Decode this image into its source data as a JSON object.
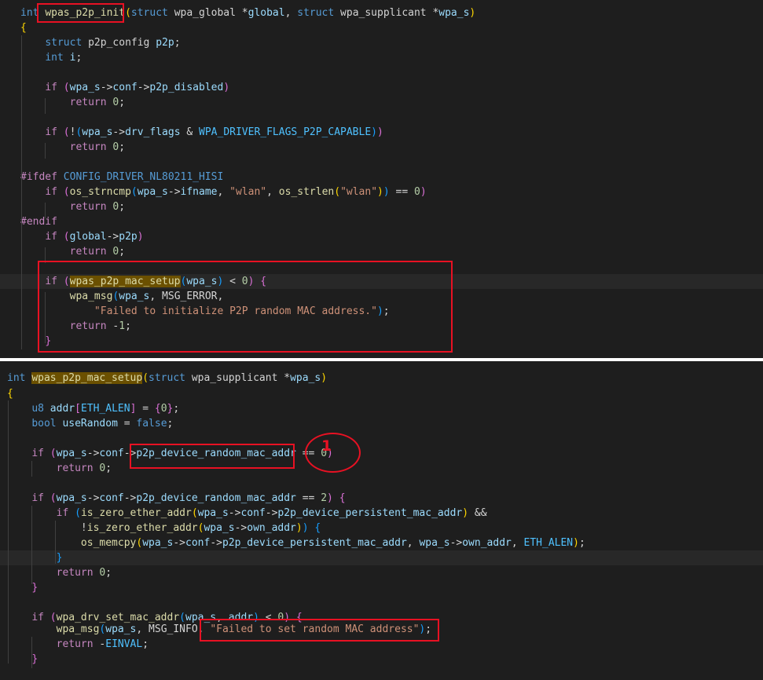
{
  "top_panel": {
    "lines": [
      [
        [
          "k",
          "int"
        ],
        [
          "t",
          " "
        ],
        [
          "f",
          "wpas_p2p_init"
        ],
        [
          "y",
          "("
        ],
        [
          "k",
          "struct"
        ],
        [
          "t",
          " "
        ],
        [
          "t",
          "wpa_global"
        ],
        [
          "t",
          " *"
        ],
        [
          "v",
          "global"
        ],
        [
          "t",
          ", "
        ],
        [
          "k",
          "struct"
        ],
        [
          "t",
          " "
        ],
        [
          "t",
          "wpa_supplicant"
        ],
        [
          "t",
          " *"
        ],
        [
          "v",
          "wpa_s"
        ],
        [
          "y",
          ")"
        ]
      ],
      [
        [
          "y",
          "{"
        ]
      ],
      [
        [
          "t",
          "    "
        ],
        [
          "k",
          "struct"
        ],
        [
          "t",
          " p2p_config "
        ],
        [
          "v",
          "p2p"
        ],
        [
          "t",
          ";"
        ]
      ],
      [
        [
          "t",
          "    "
        ],
        [
          "k",
          "int"
        ],
        [
          "t",
          " "
        ],
        [
          "v",
          "i"
        ],
        [
          "t",
          ";"
        ]
      ],
      [],
      [
        [
          "t",
          "    "
        ],
        [
          "pp",
          "if"
        ],
        [
          "t",
          " "
        ],
        [
          "p",
          "("
        ],
        [
          "v",
          "wpa_s"
        ],
        [
          "t",
          "->"
        ],
        [
          "v",
          "conf"
        ],
        [
          "t",
          "->"
        ],
        [
          "v",
          "p2p_disabled"
        ],
        [
          "p",
          ")"
        ]
      ],
      [
        [
          "t",
          "        "
        ],
        [
          "pp",
          "return"
        ],
        [
          "t",
          " "
        ],
        [
          "n",
          "0"
        ],
        [
          "t",
          ";"
        ]
      ],
      [],
      [
        [
          "t",
          "    "
        ],
        [
          "pp",
          "if"
        ],
        [
          "t",
          " "
        ],
        [
          "p",
          "("
        ],
        [
          "t",
          "!"
        ],
        [
          "bl",
          "("
        ],
        [
          "v",
          "wpa_s"
        ],
        [
          "t",
          "->"
        ],
        [
          "v",
          "drv_flags"
        ],
        [
          "t",
          " & "
        ],
        [
          "m",
          "WPA_DRIVER_FLAGS_P2P_CAPABLE"
        ],
        [
          "bl",
          ")"
        ],
        [
          "p",
          ")"
        ]
      ],
      [
        [
          "t",
          "        "
        ],
        [
          "pp",
          "return"
        ],
        [
          "t",
          " "
        ],
        [
          "n",
          "0"
        ],
        [
          "t",
          ";"
        ]
      ],
      [],
      [
        [
          "pp",
          "#ifdef"
        ],
        [
          "t",
          " "
        ],
        [
          "k",
          "CONFIG_DRIVER_NL80211_HISI"
        ]
      ],
      [
        [
          "t",
          "    "
        ],
        [
          "pp",
          "if"
        ],
        [
          "t",
          " "
        ],
        [
          "p",
          "("
        ],
        [
          "f",
          "os_strncmp"
        ],
        [
          "bl",
          "("
        ],
        [
          "v",
          "wpa_s"
        ],
        [
          "t",
          "->"
        ],
        [
          "v",
          "ifname"
        ],
        [
          "t",
          ", "
        ],
        [
          "s",
          "\"wlan\""
        ],
        [
          "t",
          ", "
        ],
        [
          "f",
          "os_strlen"
        ],
        [
          "y",
          "("
        ],
        [
          "s",
          "\"wlan\""
        ],
        [
          "y",
          ")"
        ],
        [
          "bl",
          ")"
        ],
        [
          "t",
          " == "
        ],
        [
          "n",
          "0"
        ],
        [
          "p",
          ")"
        ]
      ],
      [
        [
          "t",
          "        "
        ],
        [
          "pp",
          "return"
        ],
        [
          "t",
          " "
        ],
        [
          "n",
          "0"
        ],
        [
          "t",
          ";"
        ]
      ],
      [
        [
          "pp",
          "#endif"
        ]
      ],
      [
        [
          "t",
          "    "
        ],
        [
          "pp",
          "if"
        ],
        [
          "t",
          " "
        ],
        [
          "p",
          "("
        ],
        [
          "v",
          "global"
        ],
        [
          "t",
          "->"
        ],
        [
          "v",
          "p2p"
        ],
        [
          "p",
          ")"
        ]
      ],
      [
        [
          "t",
          "        "
        ],
        [
          "pp",
          "return"
        ],
        [
          "t",
          " "
        ],
        [
          "n",
          "0"
        ],
        [
          "t",
          ";"
        ]
      ],
      [],
      [
        [
          "t",
          "    "
        ],
        [
          "pp",
          "if"
        ],
        [
          "t",
          " "
        ],
        [
          "p",
          "("
        ],
        [
          "match",
          "wpas_p2p_mac_setup"
        ],
        [
          "bl",
          "("
        ],
        [
          "v",
          "wpa_s"
        ],
        [
          "bl",
          ")"
        ],
        [
          "t",
          " < "
        ],
        [
          "n",
          "0"
        ],
        [
          "p",
          ")"
        ],
        [
          "t",
          " "
        ],
        [
          "p",
          "{"
        ]
      ],
      [
        [
          "t",
          "        "
        ],
        [
          "f",
          "wpa_msg"
        ],
        [
          "bl",
          "("
        ],
        [
          "v",
          "wpa_s"
        ],
        [
          "t",
          ", MSG_ERROR,"
        ]
      ],
      [
        [
          "t",
          "            "
        ],
        [
          "s",
          "\"Failed to initialize P2P random MAC address.\""
        ],
        [
          "bl",
          ")"
        ],
        [
          "t",
          ";"
        ]
      ],
      [
        [
          "t",
          "        "
        ],
        [
          "pp",
          "return"
        ],
        [
          "t",
          " -"
        ],
        [
          "n",
          "1"
        ],
        [
          "t",
          ";"
        ]
      ],
      [
        [
          "t",
          "    "
        ],
        [
          "p",
          "}"
        ]
      ]
    ]
  },
  "bottom_panel": {
    "lines": [
      [
        [
          "k",
          "int"
        ],
        [
          "t",
          " "
        ],
        [
          "match",
          "wpas_p2p_mac_setup"
        ],
        [
          "y",
          "("
        ],
        [
          "k",
          "struct"
        ],
        [
          "t",
          " wpa_supplicant *"
        ],
        [
          "v",
          "wpa_s"
        ],
        [
          "y",
          ")"
        ]
      ],
      [
        [
          "y",
          "{"
        ]
      ],
      [],
      [
        [
          "t",
          "    "
        ],
        [
          "k",
          "u8"
        ],
        [
          "t",
          " "
        ],
        [
          "v",
          "addr"
        ],
        [
          "p",
          "["
        ],
        [
          "m",
          "ETH_ALEN"
        ],
        [
          "p",
          "]"
        ],
        [
          "t",
          " = "
        ],
        [
          "p",
          "{"
        ],
        [
          "n",
          "0"
        ],
        [
          "p",
          "}"
        ],
        [
          "t",
          ";"
        ]
      ],
      [
        [
          "t",
          "    "
        ],
        [
          "k",
          "bool"
        ],
        [
          "t",
          " "
        ],
        [
          "v",
          "useRandom"
        ],
        [
          "t",
          " = "
        ],
        [
          "k",
          "false"
        ],
        [
          "t",
          ";"
        ]
      ],
      [],
      [
        [
          "t",
          "    "
        ],
        [
          "pp",
          "if"
        ],
        [
          "t",
          " "
        ],
        [
          "p",
          "("
        ],
        [
          "v",
          "wpa_s"
        ],
        [
          "t",
          "->"
        ],
        [
          "v",
          "conf"
        ],
        [
          "t",
          "->"
        ],
        [
          "v",
          "p2p_device_random_mac_addr"
        ],
        [
          "t",
          " == "
        ],
        [
          "n",
          "0"
        ],
        [
          "p",
          ")"
        ]
      ],
      [
        [
          "t",
          "        "
        ],
        [
          "pp",
          "return"
        ],
        [
          "t",
          " "
        ],
        [
          "n",
          "0"
        ],
        [
          "t",
          ";"
        ]
      ],
      [],
      [
        [
          "t",
          "    "
        ],
        [
          "pp",
          "if"
        ],
        [
          "t",
          " "
        ],
        [
          "p",
          "("
        ],
        [
          "v",
          "wpa_s"
        ],
        [
          "t",
          "->"
        ],
        [
          "v",
          "conf"
        ],
        [
          "t",
          "->"
        ],
        [
          "v",
          "p2p_device_random_mac_addr"
        ],
        [
          "t",
          " == "
        ],
        [
          "n",
          "2"
        ],
        [
          "p",
          ")"
        ],
        [
          "t",
          " "
        ],
        [
          "p",
          "{"
        ]
      ],
      [
        [
          "t",
          "        "
        ],
        [
          "pp",
          "if"
        ],
        [
          "t",
          " "
        ],
        [
          "bl",
          "("
        ],
        [
          "f",
          "is_zero_ether_addr"
        ],
        [
          "y",
          "("
        ],
        [
          "v",
          "wpa_s"
        ],
        [
          "t",
          "->"
        ],
        [
          "v",
          "conf"
        ],
        [
          "t",
          "->"
        ],
        [
          "v",
          "p2p_device_persistent_mac_addr"
        ],
        [
          "y",
          ")"
        ],
        [
          "t",
          " &&"
        ]
      ],
      [
        [
          "t",
          "            !"
        ],
        [
          "f",
          "is_zero_ether_addr"
        ],
        [
          "y",
          "("
        ],
        [
          "v",
          "wpa_s"
        ],
        [
          "t",
          "->"
        ],
        [
          "v",
          "own_addr"
        ],
        [
          "y",
          ")"
        ],
        [
          "bl",
          ")"
        ],
        [
          "t",
          " "
        ],
        [
          "bl",
          "{"
        ]
      ],
      [
        [
          "t",
          "            "
        ],
        [
          "f",
          "os_memcpy"
        ],
        [
          "y",
          "("
        ],
        [
          "v",
          "wpa_s"
        ],
        [
          "t",
          "->"
        ],
        [
          "v",
          "conf"
        ],
        [
          "t",
          "->"
        ],
        [
          "v",
          "p2p_device_persistent_mac_addr"
        ],
        [
          "t",
          ", "
        ],
        [
          "v",
          "wpa_s"
        ],
        [
          "t",
          "->"
        ],
        [
          "v",
          "own_addr"
        ],
        [
          "t",
          ", "
        ],
        [
          "m",
          "ETH_ALEN"
        ],
        [
          "y",
          ")"
        ],
        [
          "t",
          ";"
        ]
      ],
      [
        [
          "t",
          "        "
        ],
        [
          "bl",
          "}"
        ]
      ],
      [
        [
          "t",
          "        "
        ],
        [
          "pp",
          "return"
        ],
        [
          "t",
          " "
        ],
        [
          "n",
          "0"
        ],
        [
          "t",
          ";"
        ]
      ],
      [
        [
          "t",
          "    "
        ],
        [
          "p",
          "}"
        ]
      ],
      [],
      [
        [
          "t",
          "    "
        ],
        [
          "pp",
          "if"
        ],
        [
          "t",
          " "
        ],
        [
          "p",
          "("
        ],
        [
          "f",
          "wpa_drv_set_mac_addr"
        ],
        [
          "bl",
          "("
        ],
        [
          "v",
          "wpa_s"
        ],
        [
          "t",
          ", "
        ],
        [
          "v",
          "addr"
        ],
        [
          "bl",
          ")"
        ],
        [
          "t",
          " < "
        ],
        [
          "n",
          "0"
        ],
        [
          "p",
          ")"
        ],
        [
          "t",
          " "
        ],
        [
          "p",
          "{"
        ]
      ],
      [
        [
          "t",
          "        "
        ],
        [
          "f",
          "wpa_msg"
        ],
        [
          "bl",
          "("
        ],
        [
          "v",
          "wpa_s"
        ],
        [
          "t",
          ", MSG_INFO, "
        ],
        [
          "s",
          "\"Failed to set random MAC address\""
        ],
        [
          "bl",
          ")"
        ],
        [
          "t",
          ";"
        ]
      ],
      [
        [
          "t",
          "        "
        ],
        [
          "pp",
          "return"
        ],
        [
          "t",
          " -"
        ],
        [
          "m",
          "EINVAL"
        ],
        [
          "t",
          ";"
        ]
      ],
      [
        [
          "t",
          "    "
        ],
        [
          "p",
          "}"
        ]
      ]
    ]
  },
  "annotations": {
    "marker_label": "1",
    "color": "#e81123"
  }
}
